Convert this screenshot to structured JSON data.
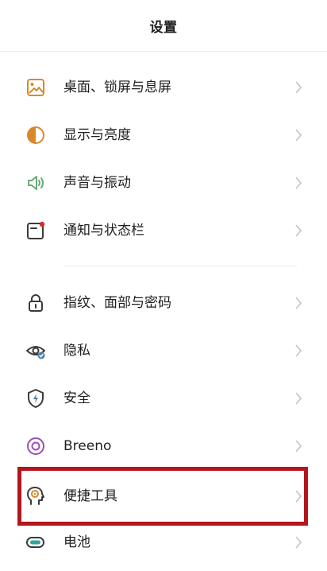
{
  "header": {
    "title": "设置"
  },
  "settings": {
    "items": [
      {
        "label": "桌面、锁屏与息屏",
        "icon": "wallpaper-icon"
      },
      {
        "label": "显示与亮度",
        "icon": "brightness-icon"
      },
      {
        "label": "声音与振动",
        "icon": "sound-icon"
      },
      {
        "label": "通知与状态栏",
        "icon": "notification-icon"
      },
      {
        "label": "指纹、面部与密码",
        "icon": "lock-icon"
      },
      {
        "label": "隐私",
        "icon": "privacy-eye-icon"
      },
      {
        "label": "安全",
        "icon": "shield-icon"
      },
      {
        "label": "Breeno",
        "icon": "breeno-icon"
      },
      {
        "label": "便捷工具",
        "icon": "convenience-tools-icon"
      },
      {
        "label": "电池",
        "icon": "battery-icon"
      }
    ]
  },
  "colors": {
    "accent_orange": "#d9892a",
    "accent_green": "#68ab78",
    "accent_blue": "#4f7fa8",
    "accent_purple": "#9a4fb5",
    "accent_teal": "#2ca7a1",
    "highlight_red": "#b3161c"
  }
}
